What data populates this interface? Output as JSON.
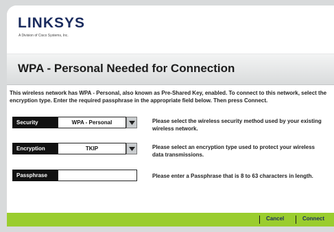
{
  "brand": {
    "name": "LINKSYS",
    "sub": "A Division of Cisco Systems, Inc."
  },
  "page_title": "WPA - Personal Needed for Connection",
  "intro": {
    "text": "This wireless network has WPA - Personal, also known as Pre-Shared Key, enabled. To connect to this network, select the encryption type. Enter the required passphrase in the appropriate field below. Then press ",
    "connect_word": "Connect",
    "end": "."
  },
  "security": {
    "label": "Security",
    "value": "WPA - Personal",
    "help": "Please select the wireless security method used by your existing wireless network."
  },
  "encryption": {
    "label": "Encryption",
    "value": "TKIP",
    "help": "Please select an encryption type used to protect your wireless data transmissions."
  },
  "passphrase": {
    "label": "Passphrase",
    "value": "",
    "help": "Please enter a Passphrase that is 8 to 63 characters in length."
  },
  "footer": {
    "cancel": "Cancel",
    "connect": "Connect"
  },
  "colors": {
    "footer_green": "#9acd2e",
    "label_black": "#111111",
    "brand_navy": "#1a2b5e"
  },
  "icons": [
    "chevron-down-icon"
  ]
}
